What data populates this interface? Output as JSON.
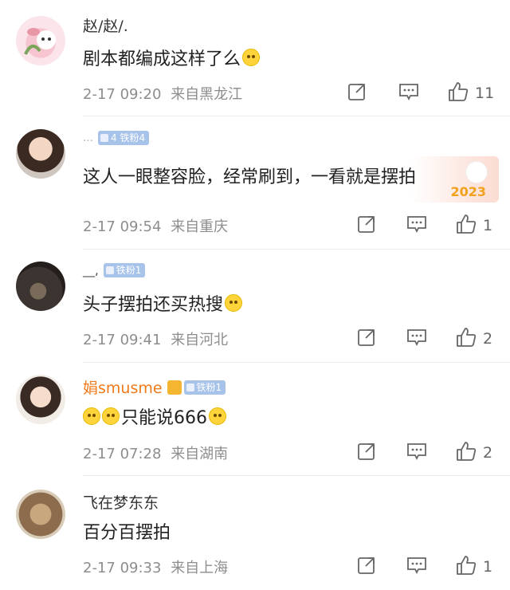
{
  "comments": [
    {
      "username": "赵/赵/.",
      "badge": "",
      "text": "剧本都编成这样了么",
      "emoji_names": [
        "dizzy-emoji"
      ],
      "time": "2-17 09:20",
      "location": "来自黑龙江",
      "likes": "11"
    },
    {
      "username": "…",
      "badge": "4 铁粉4",
      "text": "这人一眼整容脸，经常刷到，一看就是摆拍",
      "emoji_names": [],
      "time": "2-17 09:54",
      "location": "来自重庆",
      "likes": "1",
      "decoration": "2023"
    },
    {
      "username": "__,",
      "badge": "铁粉1",
      "text": "头子摆拍还买热搜",
      "emoji_names": [
        "666-emoji"
      ],
      "time": "2-17 09:41",
      "location": "来自河北",
      "likes": "2"
    },
    {
      "username": "娟smusme",
      "badge": "铁粉1",
      "text": "只能说666",
      "emoji_names": [
        "laugh-cry-emoji",
        "laugh-cry-emoji",
        "laugh-cry-emoji"
      ],
      "time": "2-17 07:28",
      "location": "来自湖南",
      "likes": "2"
    },
    {
      "username": "飞在梦东东",
      "badge": "",
      "text": "百分百摆拍",
      "emoji_names": [],
      "time": "2-17 09:33",
      "location": "来自上海",
      "likes": "1"
    }
  ],
  "icons": {
    "share": "share-icon",
    "comment": "comment-icon",
    "like": "thumbs-up-icon"
  },
  "colors": {
    "badge": "#a7c3ea",
    "meta_text": "#8d8d8d",
    "vip_name": "#f07a1a"
  }
}
